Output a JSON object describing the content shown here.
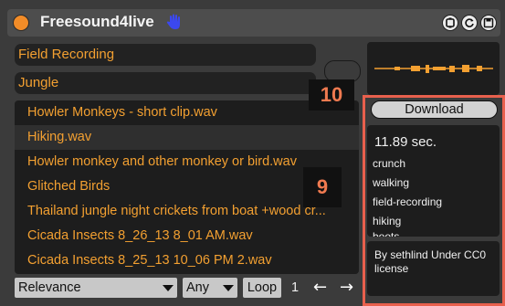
{
  "header": {
    "title": "Freesound4live",
    "colors": {
      "accent": "#f28c28",
      "hand": "#3b48f0"
    }
  },
  "search": {
    "query": "Field Recording",
    "tag": "Jungle"
  },
  "results": [
    {
      "name": "Howler Monkeys - short clip.wav",
      "selected": false
    },
    {
      "name": "Hiking.wav",
      "selected": true
    },
    {
      "name": "Howler monkey and other monkey or bird.wav",
      "selected": false
    },
    {
      "name": "Glitched Birds",
      "selected": false
    },
    {
      "name": "Thailand jungle night crickets from boat +wood cr...",
      "selected": false
    },
    {
      "name": "Cicada Insects 8_26_13 8_01 AM.wav",
      "selected": false
    },
    {
      "name": "Cicada Insects 8_25_13 10_06 PM 2.wav",
      "selected": false
    }
  ],
  "controls": {
    "sort": "Relevance",
    "filter": "Any",
    "loop_label": "Loop",
    "page": "1",
    "prev_icon": "arrow-left",
    "next_icon": "arrow-right"
  },
  "sidebar": {
    "download_label": "Download",
    "duration": "11.89 sec.",
    "tags": [
      "crunch",
      "walking",
      "field-recording",
      "hiking",
      "boots"
    ],
    "license": "By sethlind Under CC0 license"
  },
  "annotations": {
    "badge_10": "10",
    "badge_9": "9",
    "highlight_color": "#e8604d"
  }
}
